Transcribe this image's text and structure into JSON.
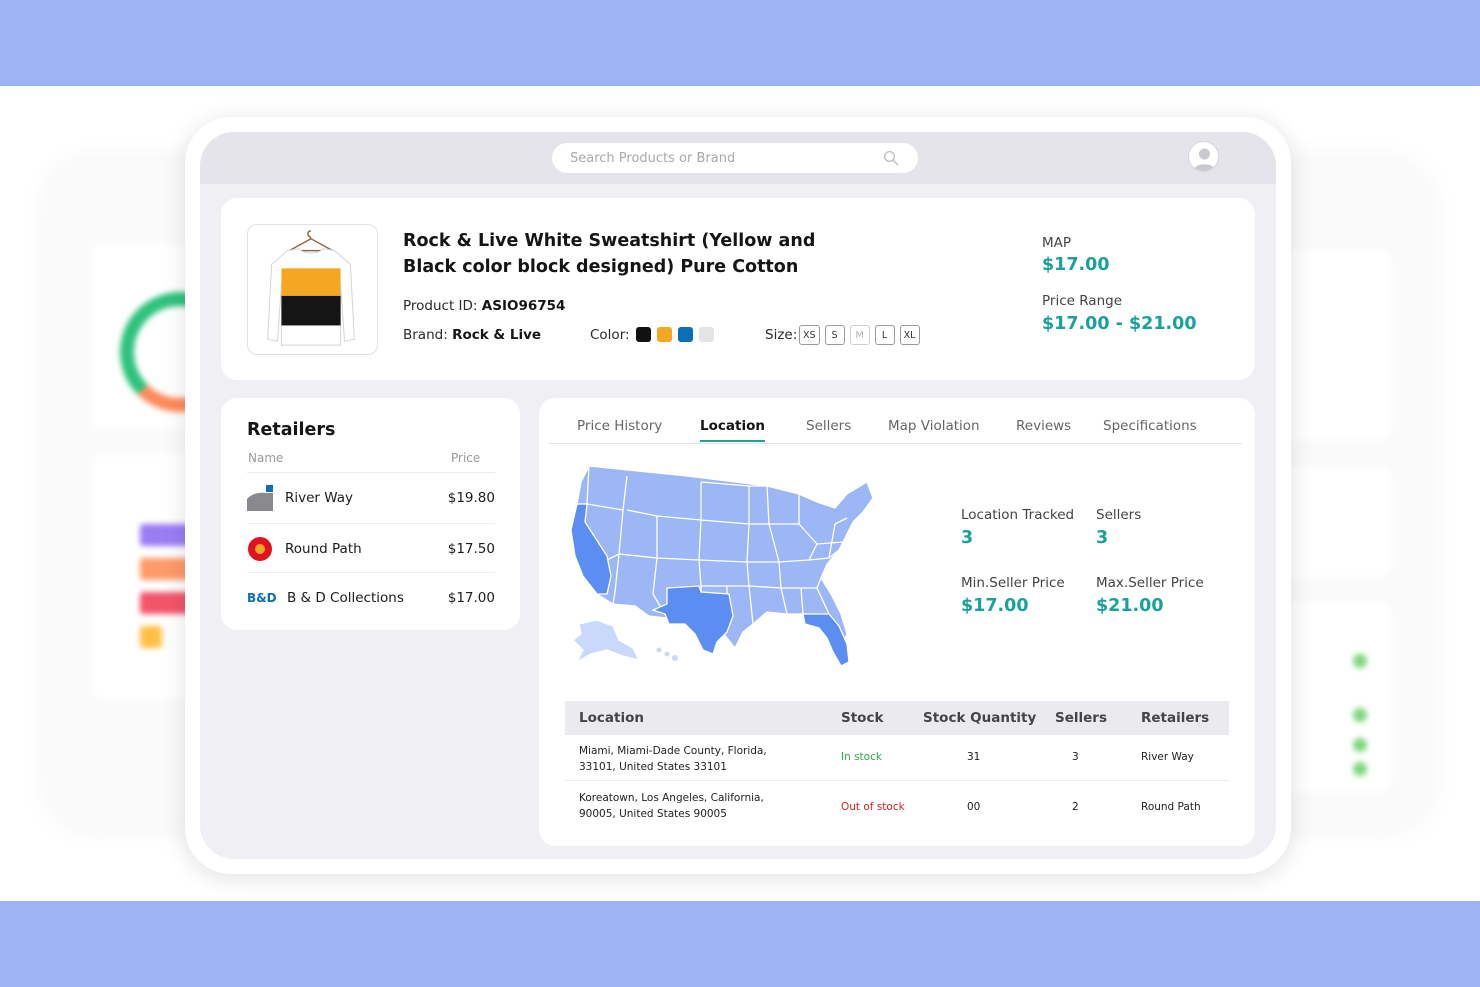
{
  "search": {
    "placeholder": "Search Products or Brand"
  },
  "product": {
    "title": "Rock & Live White Sweatshirt (Yellow and Black color block designed) Pure Cotton",
    "product_id_label": "Product ID:",
    "product_id": "ASIO96754",
    "brand_label": "Brand:",
    "brand": "Rock & Live",
    "color_label": "Color:",
    "colors": [
      "#111111",
      "#f5a623",
      "#0a6fb6",
      "#e4e4e6"
    ],
    "size_label": "Size:",
    "sizes": [
      {
        "label": "XS",
        "available": true
      },
      {
        "label": "S",
        "available": true
      },
      {
        "label": "M",
        "available": false
      },
      {
        "label": "L",
        "available": true
      },
      {
        "label": "XL",
        "available": true
      }
    ],
    "map_label": "MAP",
    "map_value": "$17.00",
    "price_range_label": "Price Range",
    "price_range_value": "$17.00 - $21.00"
  },
  "retailers": {
    "title": "Retailers",
    "col_name": "Name",
    "col_price": "Price",
    "rows": [
      {
        "name": "River Way",
        "price": "$19.80",
        "logo": "river-way-logo"
      },
      {
        "name": "Round Path",
        "price": "$17.50",
        "logo": "round-path-logo"
      },
      {
        "name": "B & D Collections",
        "price": "$17.00",
        "logo": "bd-logo",
        "logo_text": "B&D"
      }
    ]
  },
  "tabs": [
    "Price History",
    "Location",
    "Sellers",
    "Map Violation",
    "Reviews",
    "Specifications"
  ],
  "active_tab": "Location",
  "stats": {
    "location_tracked_label": "Location Tracked",
    "location_tracked": "3",
    "sellers_label": "Sellers",
    "sellers": "3",
    "min_price_label": "Min.Seller Price",
    "min_price": "$17.00",
    "max_price_label": "Max.Seller Price",
    "max_price": "$21.00"
  },
  "map_colors": {
    "base": "#9db7f6",
    "highlight": "#5b8ef0",
    "light": "#c9d8fb"
  },
  "table": {
    "headers": [
      "Location",
      "Stock",
      "Stock Quantity",
      "Sellers",
      "Retailers"
    ],
    "rows": [
      {
        "location": "Miami, Miami-Dade County, Florida, 33101, United States 33101",
        "stock": "In stock",
        "in_stock": true,
        "quantity": "31",
        "sellers": "3",
        "retailer": "River Way"
      },
      {
        "location": "Koreatown, Los Angeles, California, 90005, United States 90005",
        "stock": "Out of stock",
        "in_stock": false,
        "quantity": "00",
        "sellers": "2",
        "retailer": "Round Path"
      }
    ]
  },
  "accent": "#1aa19a"
}
